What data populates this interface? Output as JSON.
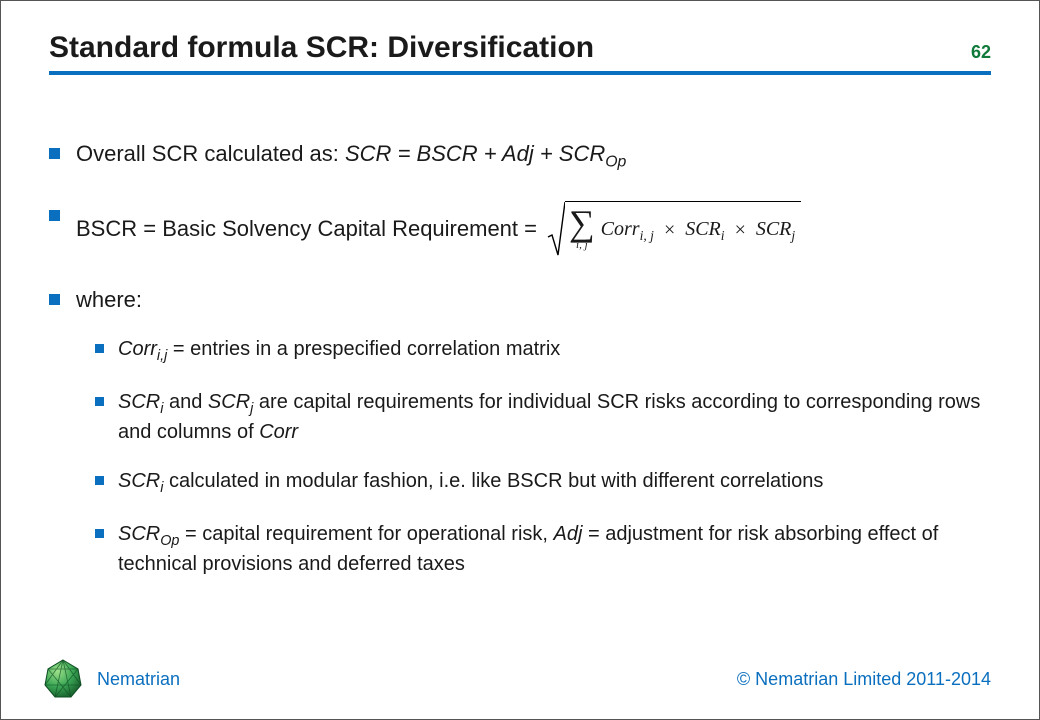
{
  "header": {
    "title": "Standard formula SCR: Diversification",
    "slide_number": "62"
  },
  "bullets": {
    "b1_prefix": "Overall SCR calculated as: ",
    "b1_formula_scr": "SCR",
    "b1_eq": " = ",
    "b1_formula_bscr": "BSCR",
    "b1_plus1": " + ",
    "b1_formula_adj": "Adj",
    "b1_plus2": " + ",
    "b1_formula_scrop": "SCR",
    "b1_formula_scrop_sub": "Op",
    "b2_text": "BSCR = Basic Solvency Capital Requirement =",
    "b3_text": "where:",
    "s1_corr": "Corr",
    "s1_corr_sub": "i,j",
    "s1_rest": " = entries in a prespecified correlation matrix",
    "s2_scri": "SCR",
    "s2_scri_sub": "i",
    "s2_and": " and ",
    "s2_scrj": "SCR",
    "s2_scrj_sub": "j",
    "s2_rest_a": " are capital requirements for individual SCR risks according to corresponding rows and columns of ",
    "s2_corr": "Corr",
    "s3_scri": "SCR",
    "s3_scri_sub": "i",
    "s3_rest": " calculated in modular fashion, i.e. like BSCR but with different correlations",
    "s4_scrop": "SCR",
    "s4_scrop_sub": "Op",
    "s4_mid1": " = capital requirement for operational risk, ",
    "s4_adj": "Adj",
    "s4_mid2": " = adjustment for risk absorbing effect of technical provisions and deferred taxes"
  },
  "formula": {
    "sigma_sub": "i, j",
    "corr": "Corr",
    "corr_sub": "i, j",
    "times": "×",
    "scr_i": "SCR",
    "scr_i_sub": "i",
    "scr_j": "SCR",
    "scr_j_sub": "j"
  },
  "footer": {
    "brand": "Nematrian",
    "copyright": "© Nematrian Limited 2011-2014"
  }
}
